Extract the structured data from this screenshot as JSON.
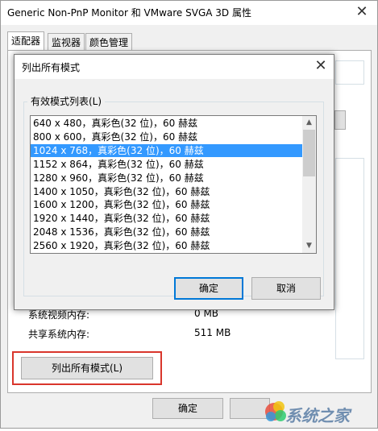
{
  "window": {
    "title": "Generic Non-PnP Monitor 和 VMware SVGA 3D 属性",
    "close_glyph": "✕",
    "tabs": [
      {
        "label": "适配器",
        "active": true
      },
      {
        "label": "监视器",
        "active": false
      },
      {
        "label": "颜色管理",
        "active": false
      }
    ],
    "memory": {
      "system_video_label": "系统视频内存:",
      "system_video_value": "0 MB",
      "shared_label": "共享系统内存:",
      "shared_value": "511 MB"
    },
    "list_all_modes_label": "列出所有模式(L)",
    "ok_label": "确定",
    "highlight_color": "#d9362c"
  },
  "dialog": {
    "title": "列出所有模式",
    "close_glyph": "✕",
    "group_label": "有效模式列表(L)",
    "modes": [
      "640 x 480，真彩色(32 位)，60 赫兹",
      "800 x 600，真彩色(32 位)，60 赫兹",
      "1024 x 768，真彩色(32 位)，60 赫兹",
      "1152 x 864，真彩色(32 位)，60 赫兹",
      "1280 x 960，真彩色(32 位)，60 赫兹",
      "1400 x 1050，真彩色(32 位)，60 赫兹",
      "1600 x 1200，真彩色(32 位)，60 赫兹",
      "1920 x 1440，真彩色(32 位)，60 赫兹",
      "2048 x 1536，真彩色(32 位)，60 赫兹",
      "2560 x 1920，真彩色(32 位)，60 赫兹"
    ],
    "selected_index": 2,
    "selection_color": "#3399ff",
    "ok_label": "确定",
    "cancel_label": "取消"
  },
  "watermark": {
    "text": "系统之家",
    "colors": [
      "#e74c3c",
      "#f1c40f",
      "#2ecc71",
      "#3498db"
    ]
  }
}
